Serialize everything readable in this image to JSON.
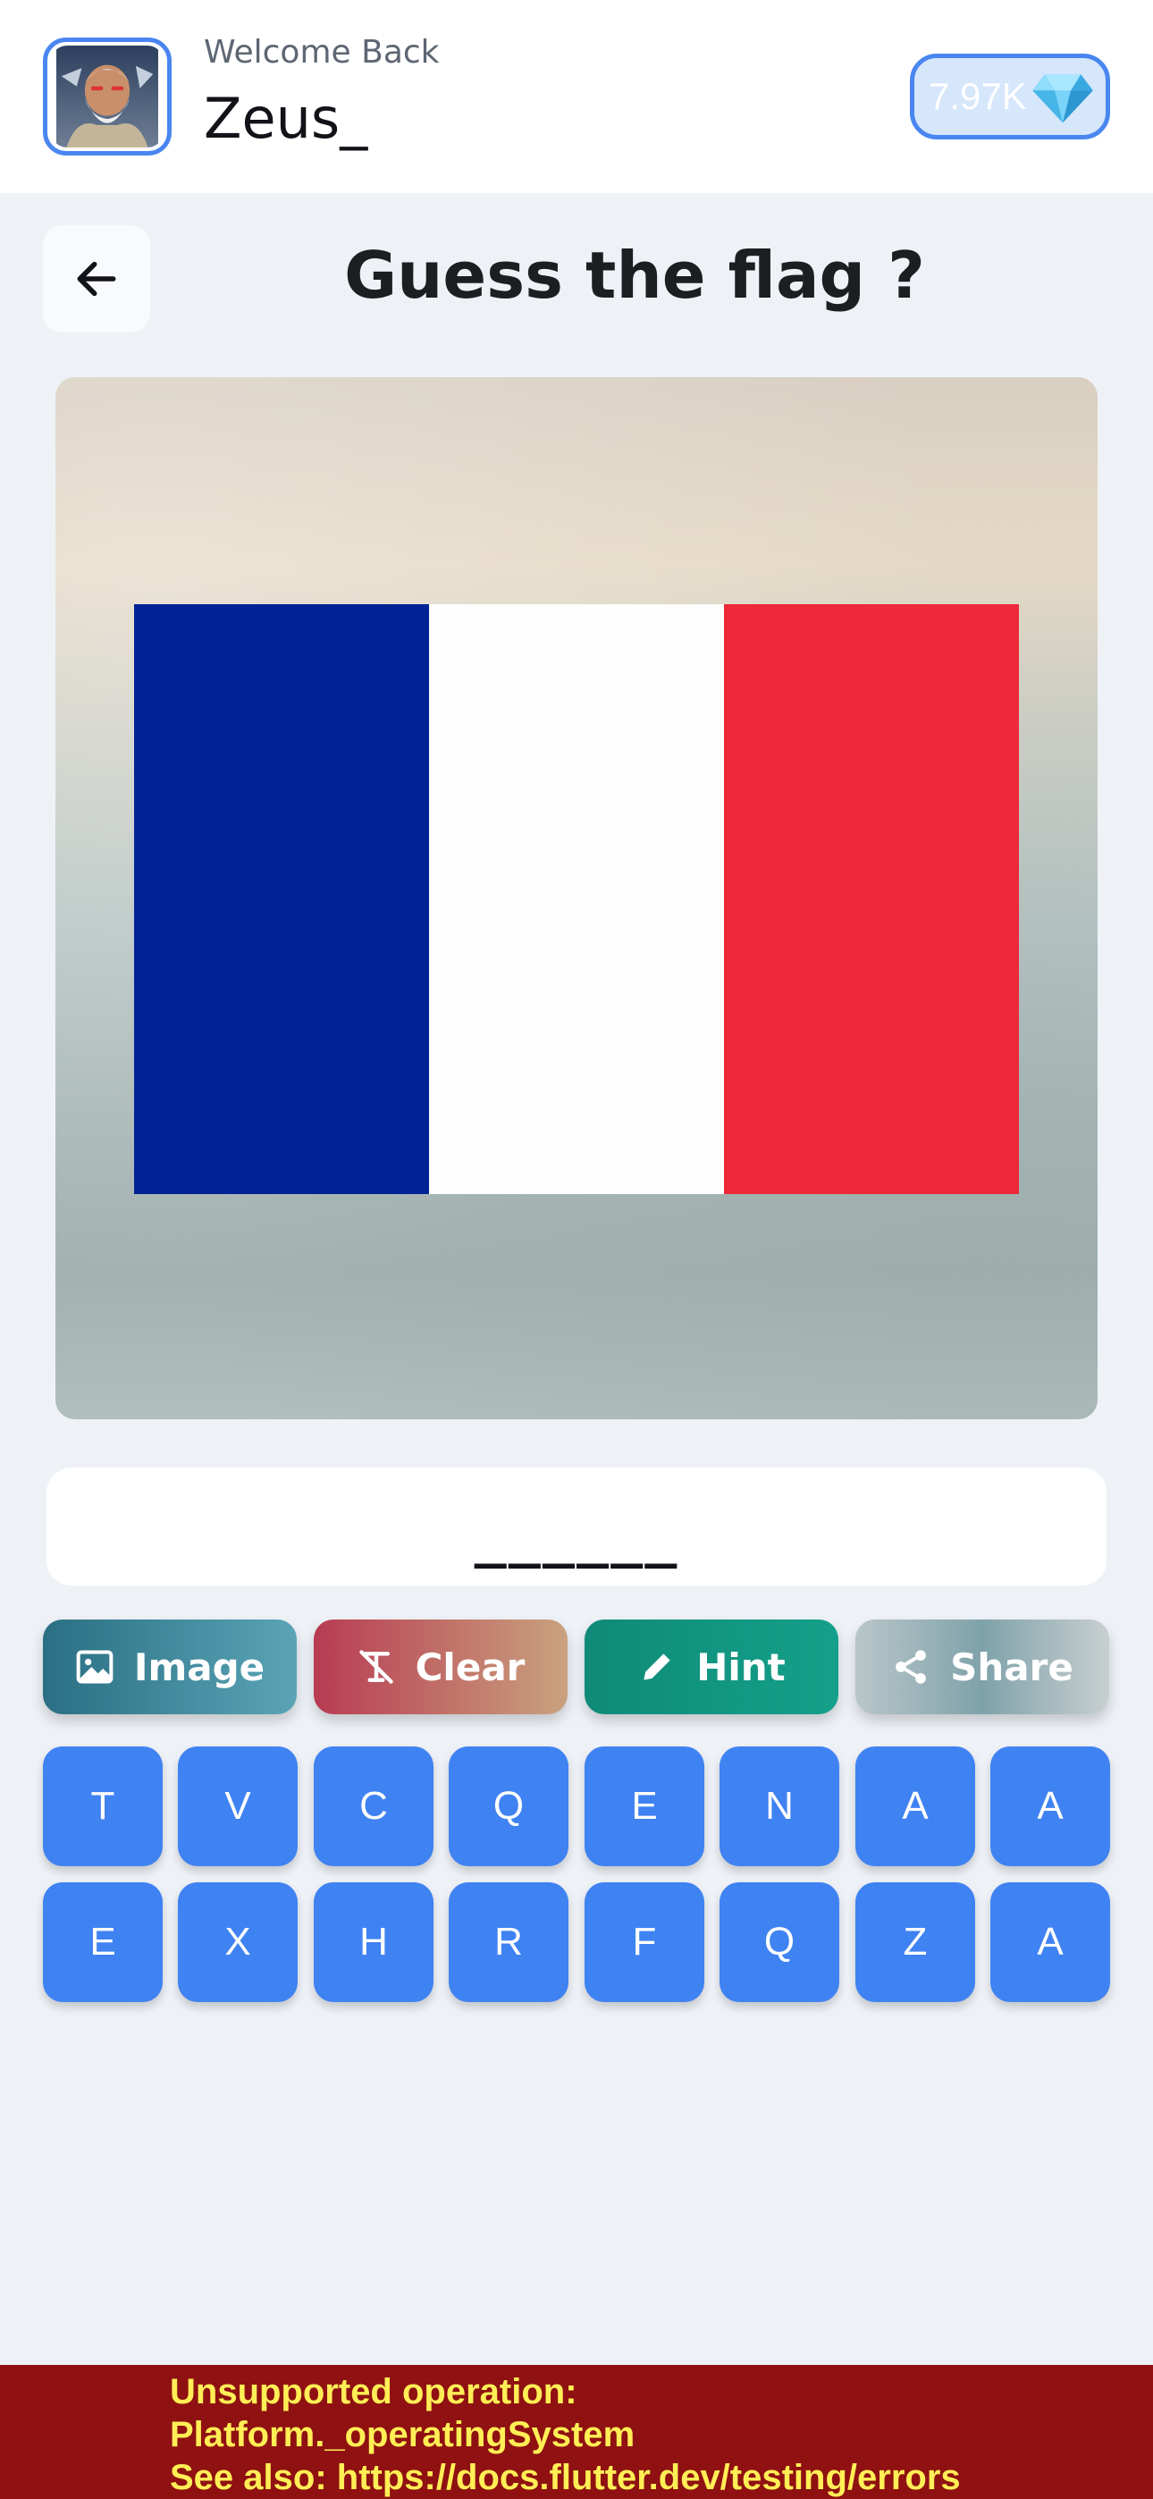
{
  "header": {
    "welcome": "Welcome Back",
    "username": "Zeus_",
    "gems": "7.97K",
    "gem_icon": "diamond-icon"
  },
  "title": "Guess the flag ?",
  "back_icon": "arrow-left-icon",
  "flag": {
    "colors": [
      "#002395",
      "#ffffff",
      "#ed2939"
    ]
  },
  "answer": "______",
  "actions": [
    {
      "label": "Image",
      "icon": "image-icon"
    },
    {
      "label": "Clear",
      "icon": "clear-format-icon"
    },
    {
      "label": "Hint",
      "icon": "pencil-icon"
    },
    {
      "label": "Share",
      "icon": "share-icon"
    }
  ],
  "keys": [
    [
      "T",
      "V",
      "C",
      "Q",
      "E",
      "N",
      "A",
      "A"
    ],
    [
      "E",
      "X",
      "H",
      "R",
      "F",
      "Q",
      "Z",
      "A"
    ]
  ],
  "error": {
    "line1": "Unsupported operation:",
    "line2": "Platform._operatingSystem",
    "line3": "See also: https://docs.flutter.dev/testing/errors"
  },
  "colors": {
    "accent": "#3f82f2",
    "error_bg": "#8f1111",
    "error_text": "#ffee55"
  }
}
